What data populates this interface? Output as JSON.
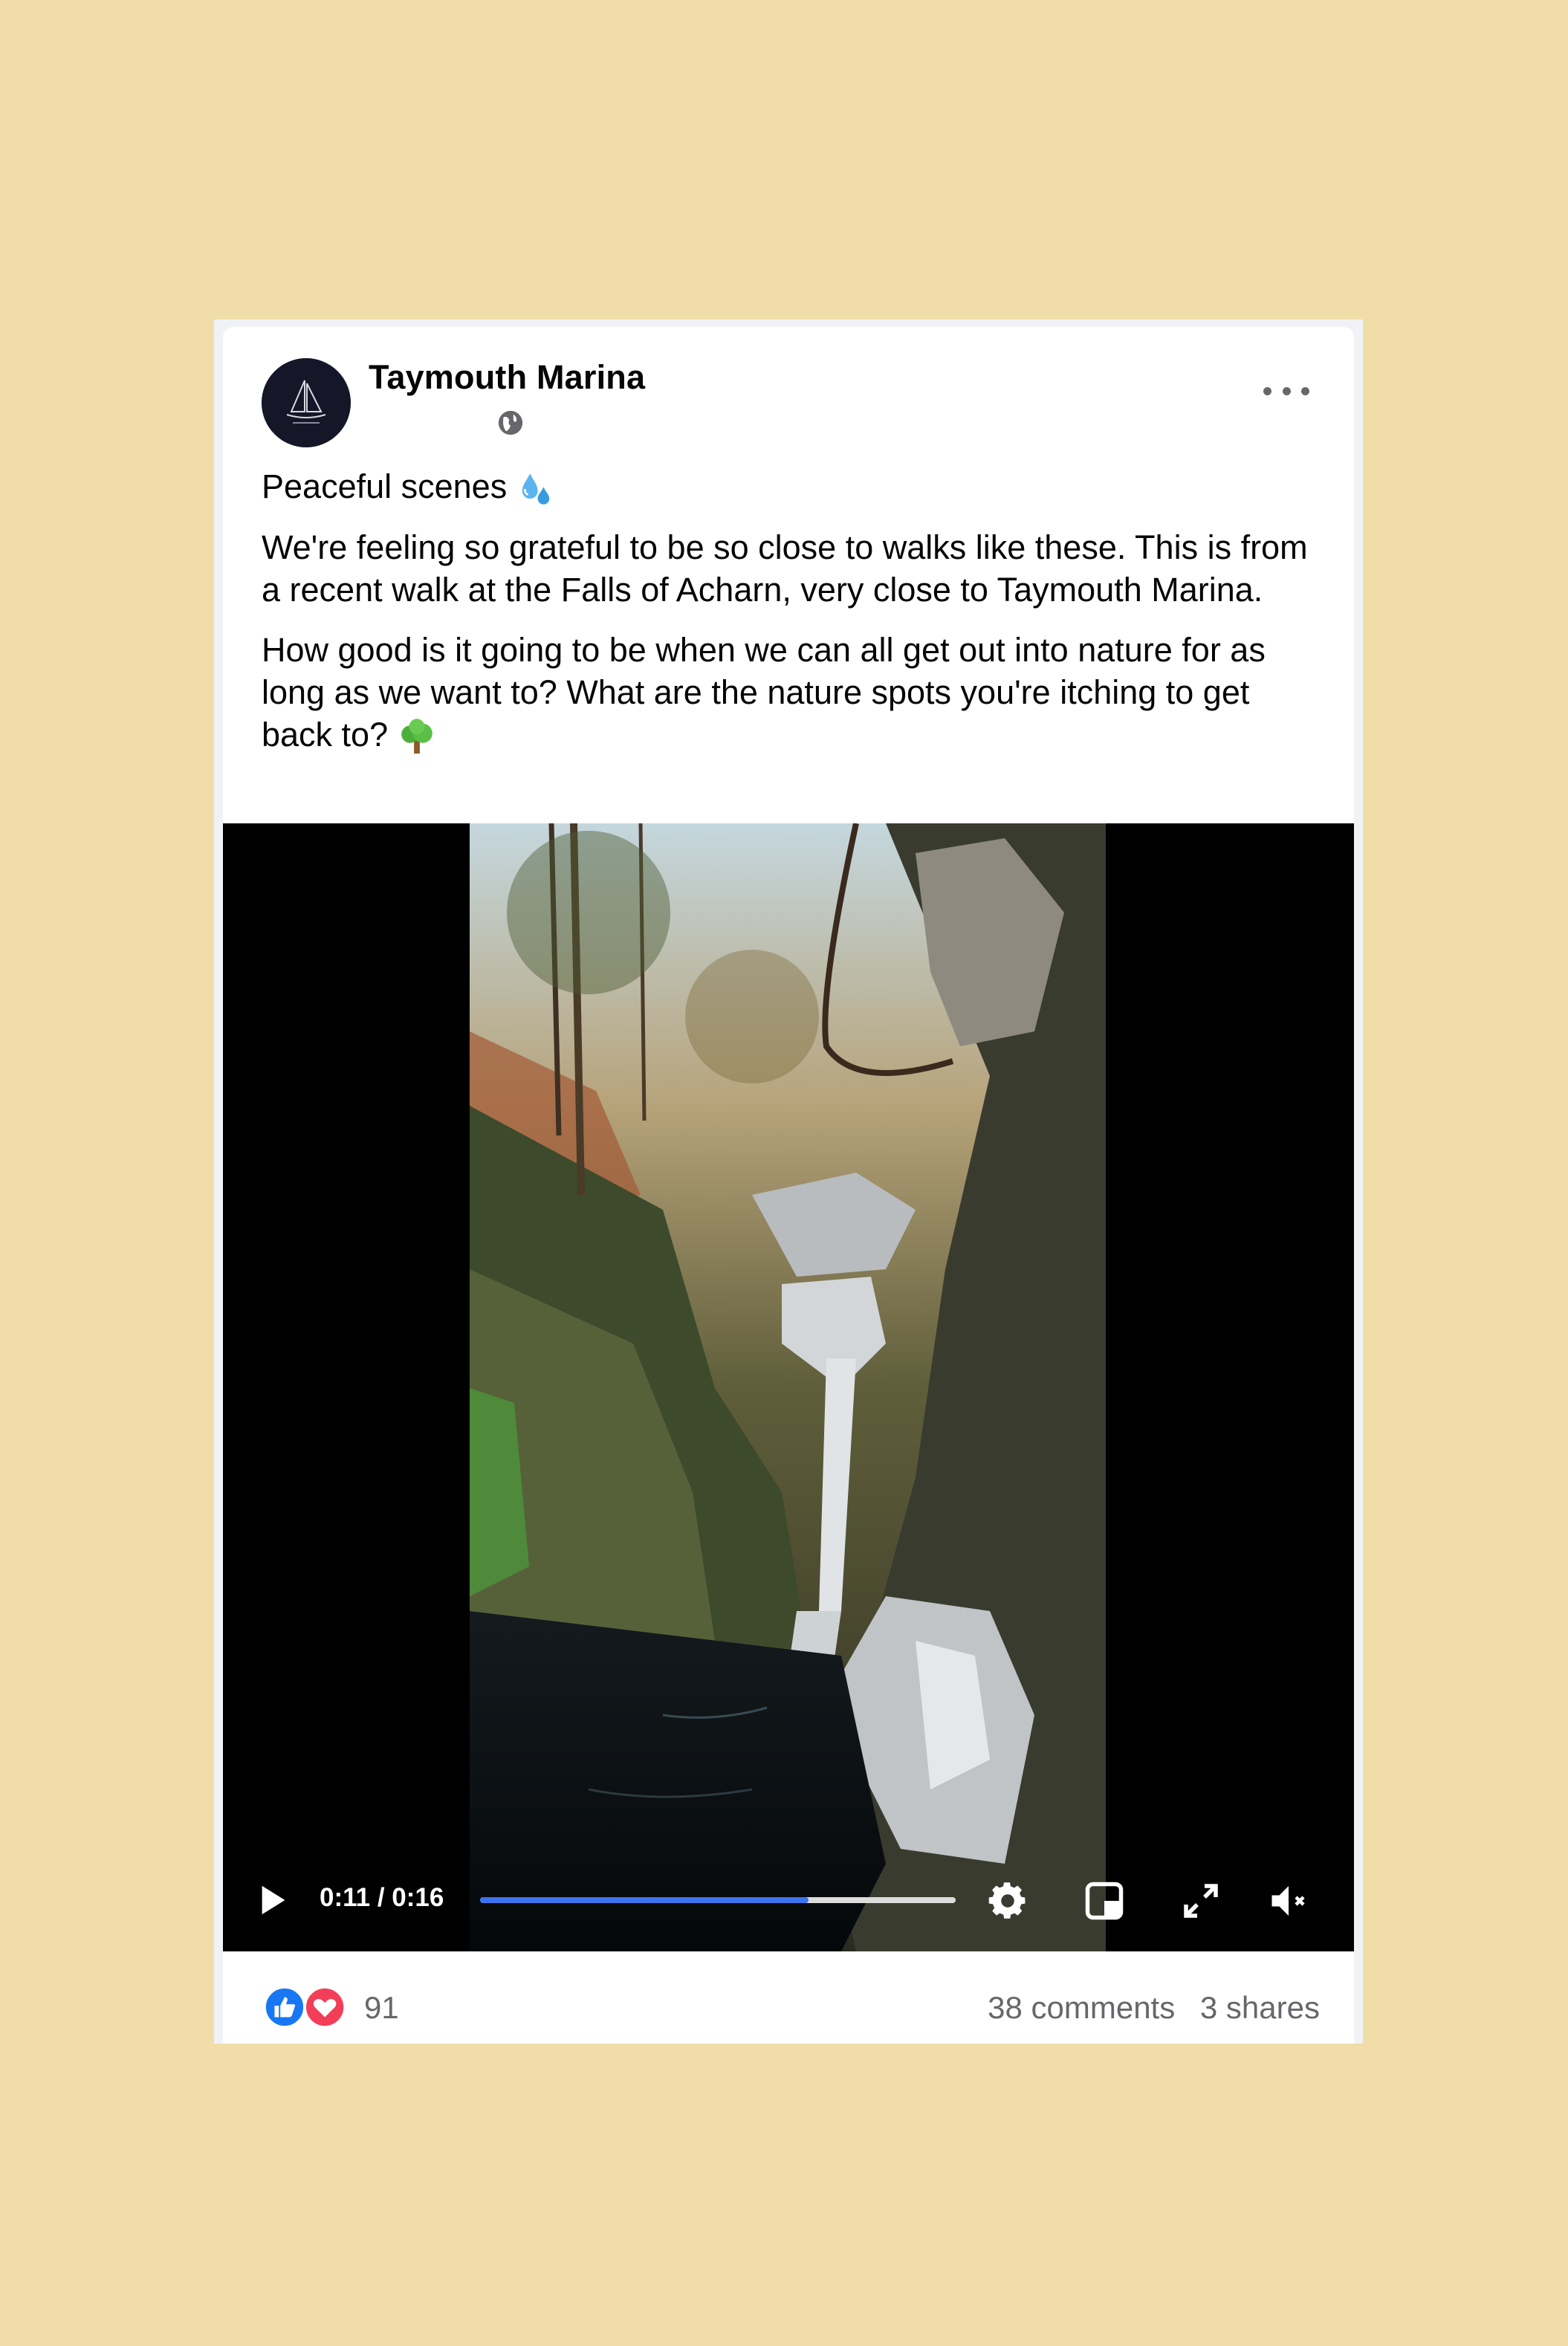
{
  "post": {
    "page_name": "Taymouth Marina",
    "privacy_icon": "globe-icon",
    "more_icon": "ellipsis-icon",
    "paragraphs": [
      "Peaceful scenes",
      "We're feeling so grateful to be so close to walks like these. This is from a recent walk at the Falls of Acharn, very close to Taymouth Marina.",
      "How good is it going to be when we can all get out into nature for as long as we want to? What are the nature spots you're itching to get back to?"
    ],
    "emojis": [
      "sweat-droplets-emoji",
      "tree-emoji"
    ]
  },
  "video": {
    "current_time": "0:11",
    "duration": "0:16",
    "time_display": "0:11 / 0:16",
    "progress": 0.69,
    "icons": [
      "play-icon",
      "settings-icon",
      "picture-in-picture-icon",
      "fullscreen-icon",
      "muted-icon"
    ]
  },
  "footer": {
    "reaction_count": "91",
    "reaction_icons": [
      "like-icon",
      "love-icon"
    ],
    "comments": "38 comments",
    "shares": "3 shares"
  },
  "colors": {
    "background": "#f1dda8",
    "progress_fill": "#3b73f0",
    "like": "#1877f2",
    "love": "#f33e58"
  }
}
